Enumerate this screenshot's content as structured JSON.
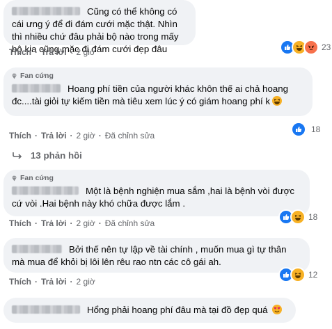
{
  "comments": [
    {
      "badge": "",
      "text": "Cũng có thể không có cái ưng ý để đi đám cưới mặc thật. Nhìn thì nhiều chứ đâu phải bộ nào trong mấy bộ kia cũng mặc đi đám cưới đẹp đâu",
      "actions": {
        "like": "Thích",
        "reply": "Trả lời",
        "time": "2 giờ",
        "edited": ""
      },
      "reaction_count": "23"
    },
    {
      "badge": "Fan cứng",
      "text": "Hoang phí tiền của người khác khôn thế ai chả hoang đc....tài giỏi tự kiếm tiền mà tiêu xem lúc ý có giám hoang phí k",
      "actions": {
        "like": "Thích",
        "reply": "Trả lời",
        "time": "2 giờ",
        "edited": "Đã chỉnh sửa"
      },
      "reaction_count": "18"
    },
    {
      "badge": "Fan cứng",
      "text": "Một là bệnh nghiện mua sắm ,hai là bệnh vòi được cứ vòi .Hai bệnh này khó chữa được lắm .",
      "actions": {
        "like": "Thích",
        "reply": "Trả lời",
        "time": "2 giờ",
        "edited": "Đã chỉnh sửa"
      },
      "reaction_count": "18"
    },
    {
      "badge": "",
      "text": "Bởi thế nên tự lập về tài chính , muốn mua gì tự thân mà mua để khỏi bị lôi lên rêu rao ntn các cô gái ah.",
      "actions": {
        "like": "Thích",
        "reply": "Trả lời",
        "time": "2 giờ",
        "edited": ""
      },
      "reaction_count": "12"
    },
    {
      "badge": "",
      "text": "Hổng phải hoang phí đâu mà tại đồ đẹp quá",
      "actions": {
        "like": "",
        "reply": "",
        "time": "",
        "edited": ""
      },
      "reaction_count": ""
    }
  ],
  "replies_label": "13 phản hồi",
  "icons": {
    "fan_badge": "diamond-badge-icon",
    "like": "like-reaction-icon",
    "haha": "haha-reaction-icon",
    "angry": "angry-reaction-icon",
    "reply_arrow": "reply-arrow-icon"
  },
  "colors": {
    "bubble": "#f0f2f5",
    "meta_text": "#65676b",
    "like_blue": "#1877f2",
    "haha_yellow": "#f7b125",
    "angry_orange": "#f7714c"
  }
}
